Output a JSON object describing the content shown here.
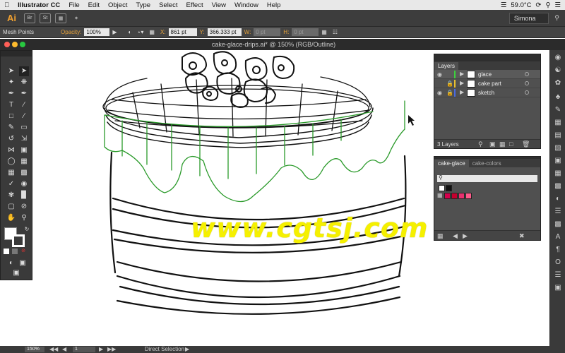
{
  "menubar": {
    "app": "Illustrator CC",
    "items": [
      "File",
      "Edit",
      "Object",
      "Type",
      "Select",
      "Effect",
      "View",
      "Window",
      "Help"
    ],
    "temperature": "59.0°C"
  },
  "appbar": {
    "logo": "Ai",
    "bridge_label": "Br",
    "stock_label": "St",
    "user": "Simona"
  },
  "control": {
    "mesh_points": "Mesh Points",
    "opacity_label": "Opacity:",
    "opacity_value": "100%",
    "x_label": "X:",
    "x_value": "861 pt",
    "y_label": "Y:",
    "y_value": "366.333 pt",
    "w_label": "W:",
    "w_value": "0 pt",
    "h_label": "H:",
    "h_value": "0 pt"
  },
  "document": {
    "title": "cake-glace-drips.ai* @ 150% (RGB/Outline)"
  },
  "layers_panel": {
    "tab": "Layers",
    "layers": [
      {
        "name": "glace",
        "color": "#3cd23c"
      },
      {
        "name": "cake part",
        "color": "#e8c030"
      },
      {
        "name": "sketch",
        "color": "#4a6ae0"
      }
    ],
    "count": "3 Layers"
  },
  "swatch_panel": {
    "tabs": [
      "cake-glace",
      "cake-colors"
    ],
    "swatches": [
      "#ffffff",
      "#111111",
      "#d4004c",
      "#c4002e",
      "#e8306e",
      "#ff5a8a"
    ]
  },
  "status": {
    "zoom": "150%",
    "artboard": "1",
    "tool": "Direct Selection"
  },
  "watermark": "www.cgtsj.com"
}
